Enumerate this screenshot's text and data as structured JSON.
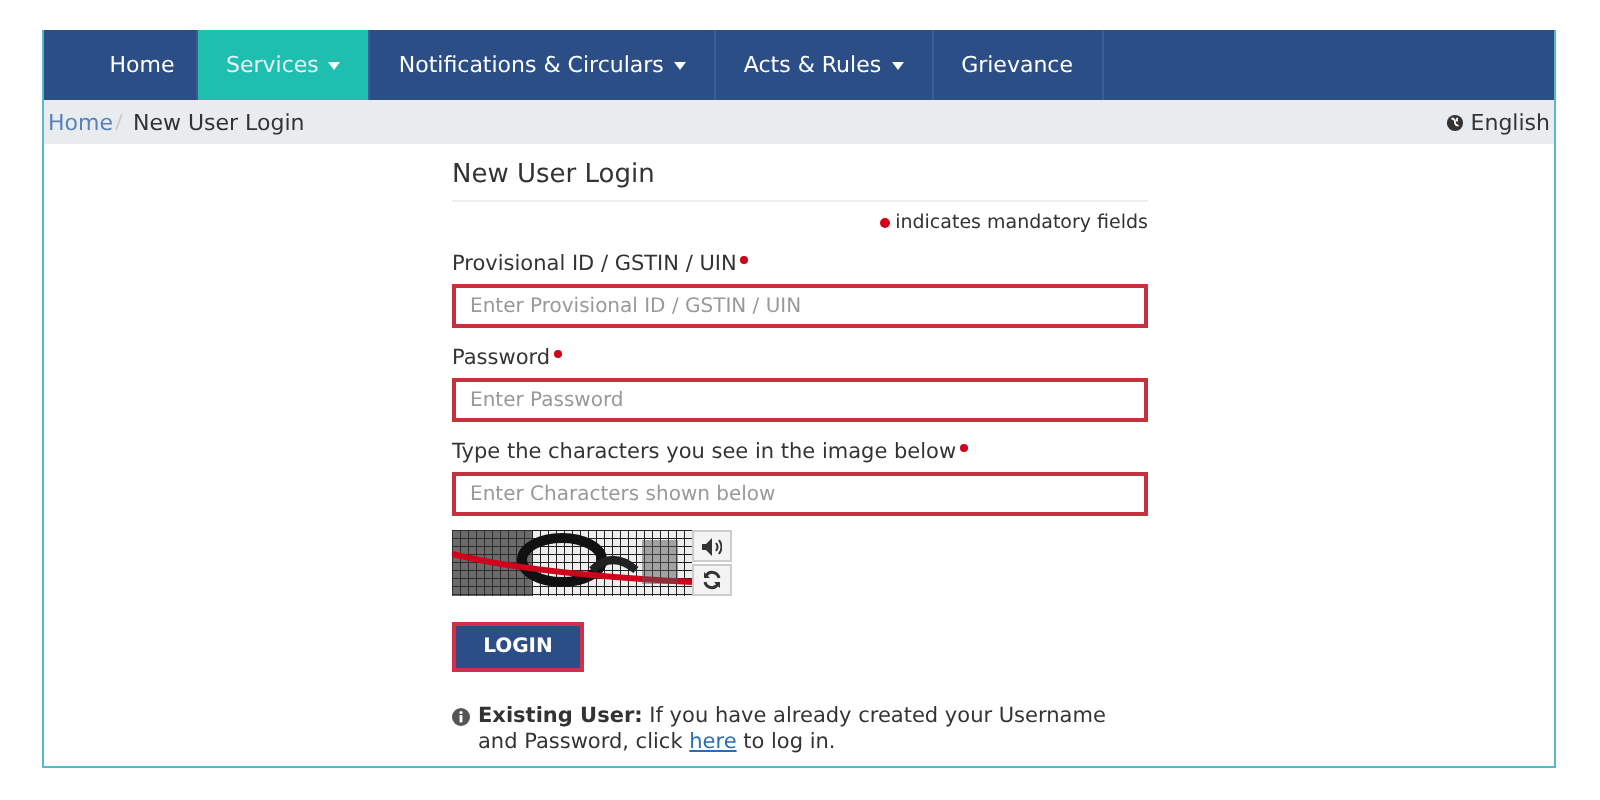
{
  "nav": [
    {
      "label": "Home",
      "dropdown": false,
      "selected": false
    },
    {
      "label": "Services",
      "dropdown": true,
      "selected": true
    },
    {
      "label": "Notifications & Circulars",
      "dropdown": true,
      "selected": false
    },
    {
      "label": "Acts & Rules",
      "dropdown": true,
      "selected": false
    },
    {
      "label": "Grievance",
      "dropdown": false,
      "selected": false
    }
  ],
  "breadcrumb": [
    {
      "label": "Home",
      "link": true
    },
    {
      "label": "New User Login",
      "link": false
    }
  ],
  "language": "English",
  "form": {
    "title": "New User Login",
    "mandatory_note": "indicates mandatory fields",
    "fields": [
      {
        "label": "Provisional ID / GSTIN / UIN",
        "placeholder": "Enter Provisional ID / GSTIN / UIN",
        "required": true,
        "invalid": true
      },
      {
        "label": "Password",
        "placeholder": "Enter Password",
        "required": true,
        "invalid": true
      },
      {
        "label": "Type the characters you see in the image below",
        "placeholder": "Enter Characters shown below",
        "required": true,
        "invalid": true
      }
    ],
    "login_button": "LOGIN",
    "existing_user": {
      "text": "**Existing User:** If you have already created your Username and Password, click",
      "link": "here",
      "text_after": "to log in."
    }
  }
}
